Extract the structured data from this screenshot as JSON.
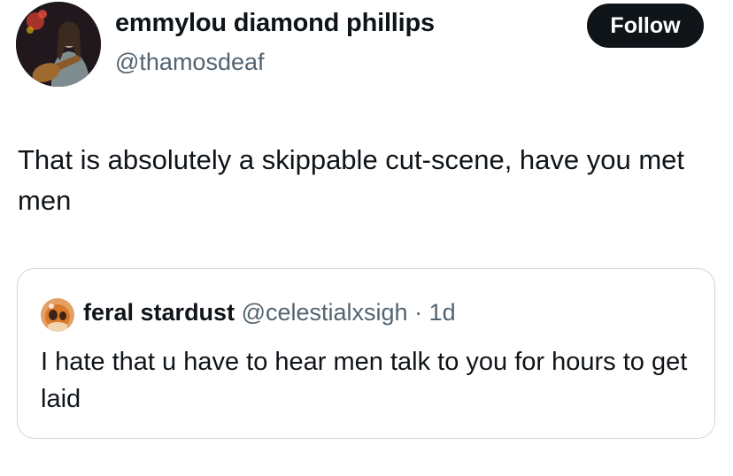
{
  "tweet": {
    "author": {
      "display_name": "emmylou diamond phillips",
      "handle": "@thamosdeaf",
      "avatar": "profile-photo-avatar"
    },
    "follow_label": "Follow",
    "text": "That is absolutely a skippable cut-scene, have you met men"
  },
  "quote": {
    "author": {
      "display_name": "feral stardust",
      "handle": "@celestialxsigh",
      "avatar": "profile-photo-avatar"
    },
    "separator": "·",
    "time": "1d",
    "text": "I hate that u have to hear men talk to you for hours to get laid"
  },
  "colors": {
    "text_primary": "#0f1419",
    "text_secondary": "#536471",
    "follow_button_bg": "#0f1419",
    "follow_button_text": "#ffffff",
    "card_border": "#cfd9de"
  }
}
